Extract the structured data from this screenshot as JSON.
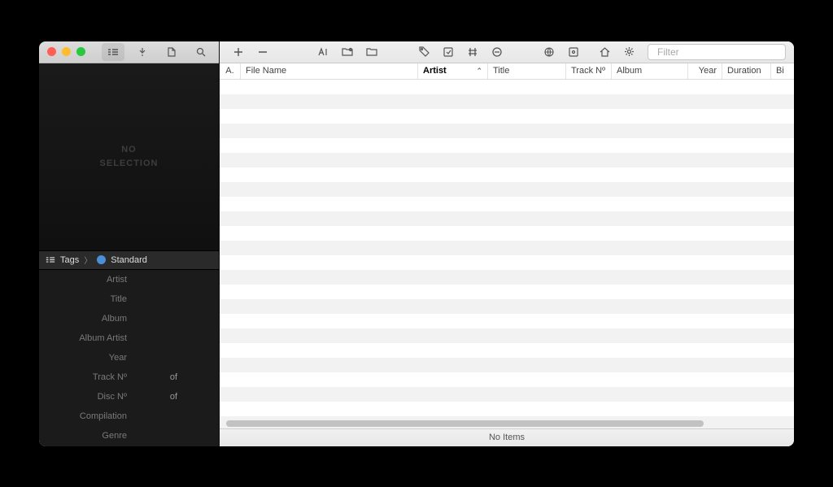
{
  "sidebar": {
    "album_placeholder_line1": "NO",
    "album_placeholder_line2": "SELECTION",
    "tags_label": "Tags",
    "preset_label": "Standard",
    "fields": [
      {
        "label": "Artist",
        "value": "",
        "of": ""
      },
      {
        "label": "Title",
        "value": "",
        "of": ""
      },
      {
        "label": "Album",
        "value": "",
        "of": ""
      },
      {
        "label": "Album Artist",
        "value": "",
        "of": ""
      },
      {
        "label": "Year",
        "value": "",
        "of": ""
      },
      {
        "label": "Track Nº",
        "value": "",
        "of": "of"
      },
      {
        "label": "Disc Nº",
        "value": "",
        "of": "of"
      },
      {
        "label": "Compilation",
        "value": "",
        "of": ""
      },
      {
        "label": "Genre",
        "value": "",
        "of": ""
      }
    ]
  },
  "toolbar": {
    "search_placeholder": "Filter"
  },
  "columns": {
    "a": "A.",
    "file": "File Name",
    "artist": "Artist",
    "title": "Title",
    "track": "Track Nº",
    "album": "Album",
    "year": "Year",
    "duration": "Duration",
    "bitrate": "Bi"
  },
  "status": {
    "text": "No Items"
  }
}
